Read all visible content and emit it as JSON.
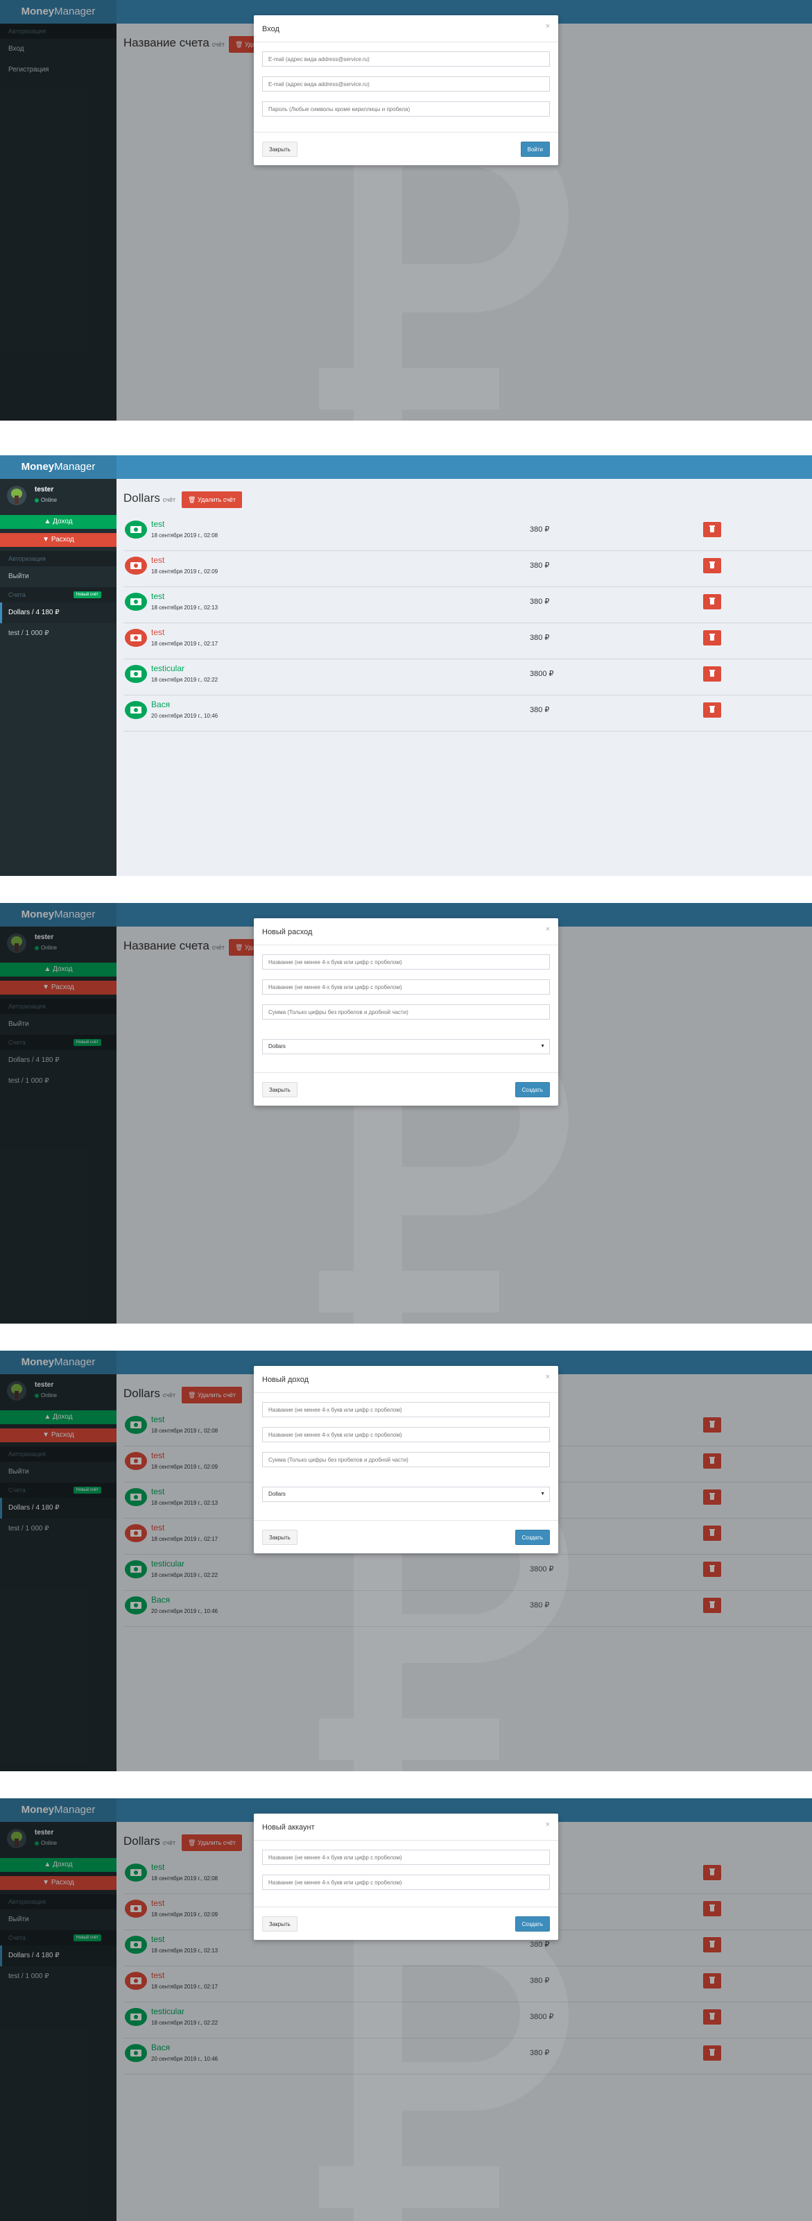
{
  "app": {
    "logo_bold": "Money",
    "logo_rest": "Manager"
  },
  "sidebar": {
    "header_auth": "Авторизация",
    "login": "Вход",
    "register": "Регистрация",
    "logout": "Выйти",
    "accounts_header": "Счета",
    "new_account_badge": "Новый счёт",
    "income_button": "Доход",
    "expense_button": "Расход",
    "accounts": [
      {
        "label": "Dollars / 4 180 ₽"
      },
      {
        "label": "test / 1 000 ₽"
      }
    ]
  },
  "user": {
    "name": "tester",
    "status": "Online"
  },
  "content": {
    "placeholder_title": "Название счета",
    "title": "Dollars",
    "title_suffix": "счёт",
    "delete_account": "Удалить счёт"
  },
  "transactions": [
    {
      "name": "test",
      "date": "18 сентября 2019 г., 02:08",
      "amount": "380 ₽",
      "kind": "income"
    },
    {
      "name": "test",
      "date": "18 сентября 2019 г., 02:09",
      "amount": "380 ₽",
      "kind": "expense"
    },
    {
      "name": "test",
      "date": "18 сентября 2019 г., 02:13",
      "amount": "380 ₽",
      "kind": "income"
    },
    {
      "name": "test",
      "date": "18 сентября 2019 г., 02:17",
      "amount": "380 ₽",
      "kind": "expense"
    },
    {
      "name": "testicular",
      "date": "18 сентября 2019 г., 02:22",
      "amount": "3800 ₽",
      "kind": "income"
    },
    {
      "name": "Вася",
      "date": "20 сентября 2019 г., 10:46",
      "amount": "380 ₽",
      "kind": "income"
    }
  ],
  "modals": {
    "login": {
      "title": "Вход",
      "email_placeholder": "E-mail (адрес вида address@service.ru)",
      "email2_placeholder": "E-mail (адрес вида address@service.ru)",
      "password_placeholder": "Пароль (Любые символы кроме кириллицы и пробела)",
      "close": "Закрыть",
      "submit": "Войти"
    },
    "expense": {
      "title": "Новый расход",
      "name_placeholder": "Название (не менее 4-х букв или цифр с пробелом)",
      "name2_placeholder": "Название (не менее 4-х букв или цифр с пробелом)",
      "sum_placeholder": "Сумма (Только цифры без пробелов и дробной части)",
      "select_value": "Dollars",
      "close": "Закрыть",
      "submit": "Создать"
    },
    "income": {
      "title": "Новый доход",
      "name_placeholder": "Название (не менее 4-х букв или цифр с пробелом)",
      "name2_placeholder": "Название (не менее 4-х букв или цифр с пробелом)",
      "sum_placeholder": "Сумма (Только цифры без пробелов и дробной части)",
      "select_value": "Dollars",
      "close": "Закрыть",
      "submit": "Создать"
    },
    "account": {
      "title": "Новый аккаунт",
      "name_placeholder": "Название (не менее 4-х букв или цифр с пробелом)",
      "name2_placeholder": "Название (не менее 4-х букв или цифр с пробелом)",
      "close": "Закрыть",
      "submit": "Создать"
    }
  },
  "colors": {
    "brand": "#3c8dbc",
    "sidebar": "#222d32",
    "income": "#00a65a",
    "expense": "#dd4b39"
  },
  "icons": {
    "transaction": "money-bill-icon",
    "delete": "trash-icon",
    "close": "close-icon"
  }
}
